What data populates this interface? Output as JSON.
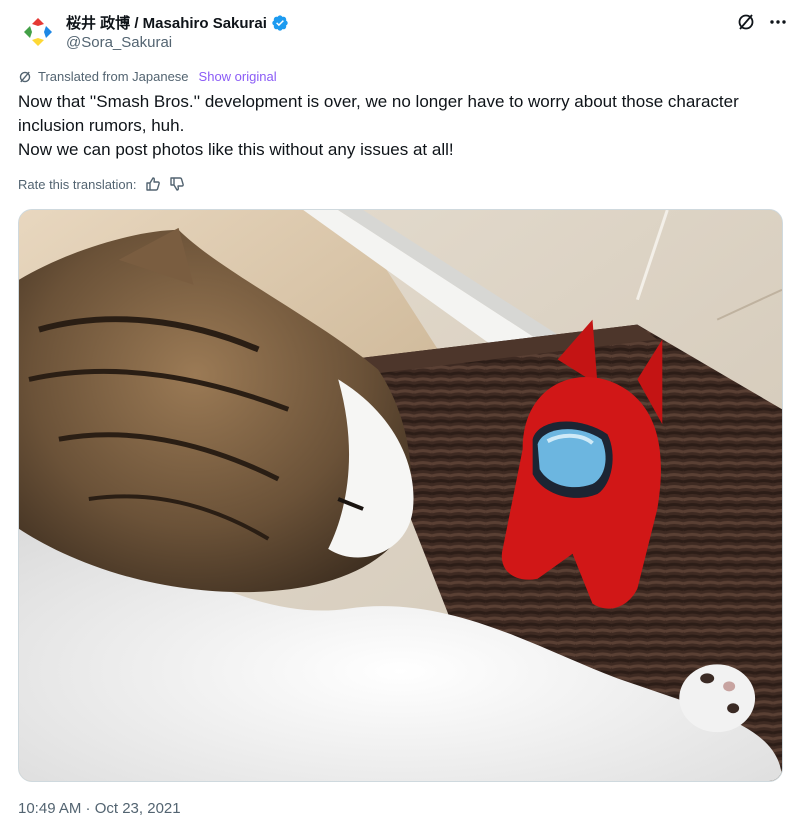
{
  "author": {
    "display_name": "桜井 政博 / Masahiro Sakurai",
    "handle": "@Sora_Sakurai",
    "verified": true
  },
  "translation": {
    "label": "Translated from Japanese",
    "show_original": "Show original",
    "rate_label": "Rate this translation:"
  },
  "tweet": {
    "lines": [
      "Now that ''Smash Bros.'' development is over, we no longer have to worry about those character inclusion rumors, huh.",
      "Now we can post photos like this without any issues at all!"
    ]
  },
  "timestamp": "10:49 AM · Oct 23, 2021",
  "colors": {
    "accent_link": "#8b5cf6",
    "verified": "#1d9bf0",
    "text_secondary": "#536471"
  }
}
